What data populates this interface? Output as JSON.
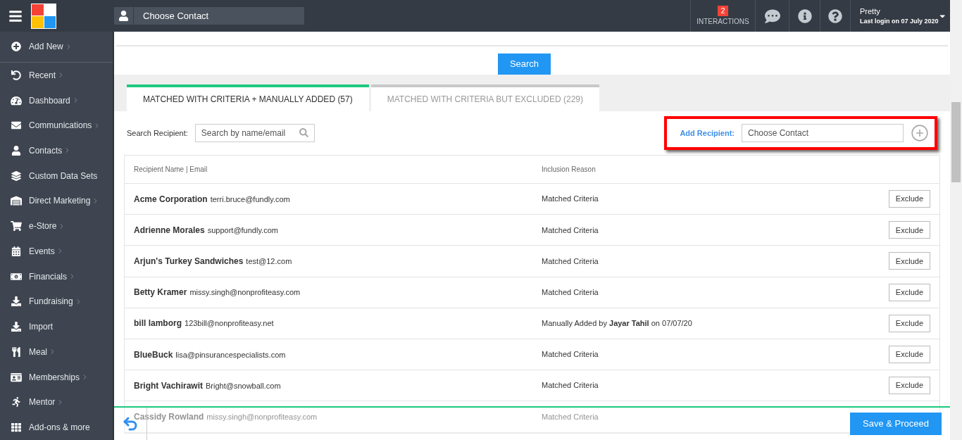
{
  "header": {
    "contact_selector": "Choose Contact",
    "interactions": {
      "count": "2",
      "label": "INTERACTIONS"
    },
    "user": {
      "name": "Pretty",
      "last_login": "Last login on 07 July 2020"
    }
  },
  "sidebar": {
    "items": [
      {
        "label": "Add New",
        "submenu": true
      },
      {
        "label": "Recent",
        "submenu": true
      },
      {
        "label": "Dashboard",
        "submenu": true
      },
      {
        "label": "Communications",
        "submenu": true
      },
      {
        "label": "Contacts",
        "submenu": true
      },
      {
        "label": "Custom Data Sets",
        "submenu": false
      },
      {
        "label": "Direct Marketing",
        "submenu": true
      },
      {
        "label": "e-Store",
        "submenu": true
      },
      {
        "label": "Events",
        "submenu": true
      },
      {
        "label": "Financials",
        "submenu": true
      },
      {
        "label": "Fundraising",
        "submenu": true
      },
      {
        "label": "Import",
        "submenu": false
      },
      {
        "label": "Meal",
        "submenu": true
      },
      {
        "label": "Memberships",
        "submenu": true
      },
      {
        "label": "Mentor",
        "submenu": true
      },
      {
        "label": "Add-ons & more",
        "submenu": false
      }
    ]
  },
  "search_button": "Search",
  "tabs": [
    {
      "label": "MATCHED WITH CRITERIA + MANUALLY ADDED (57)",
      "selected": true
    },
    {
      "label": "MATCHED WITH CRITERIA BUT EXCLUDED (229)",
      "selected": false
    }
  ],
  "search_recipient": {
    "label": "Search Recipient:",
    "placeholder": "Search by name/email"
  },
  "add_recipient": {
    "label": "Add Recipient:",
    "placeholder": "Choose Contact"
  },
  "table": {
    "columns": [
      "Recipient Name | Email",
      "Inclusion Reason"
    ],
    "rows": [
      {
        "name": "Acme Corporation",
        "email": "terri.bruce@fundly.com",
        "reason": "Matched Criteria",
        "action": "Exclude"
      },
      {
        "name": "Adrienne Morales",
        "email": "support@fundly.com",
        "reason": "Matched Criteria",
        "action": "Exclude"
      },
      {
        "name": "Arjun's Turkey Sandwiches",
        "email": "test@12.com",
        "reason": "Matched Criteria",
        "action": "Exclude"
      },
      {
        "name": "Betty Kramer",
        "email": "missy.singh@nonprofiteasy.com",
        "reason": "Matched Criteria",
        "action": "Exclude"
      },
      {
        "name": "bill lamborg",
        "email": "123bill@nonprofiteasy.net",
        "reason": "Manually Added by **Jayar Tahil** on 07/07/20",
        "action": "Exclude"
      },
      {
        "name": "BlueBuck",
        "email": "lisa@pinsurancespecialists.com",
        "reason": "Matched Criteria",
        "action": "Exclude"
      },
      {
        "name": "Bright Vachirawit",
        "email": "Bright@snowball.com",
        "reason": "Matched Criteria",
        "action": "Exclude"
      },
      {
        "name": "Cassidy Rowland",
        "email": "missy.singh@nonprofiteasy.com",
        "reason": "Matched Criteria"
      }
    ]
  },
  "footer": {
    "save_button": "Save & Proceed"
  }
}
